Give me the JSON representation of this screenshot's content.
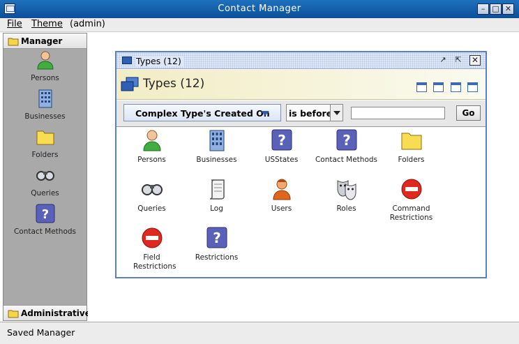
{
  "window": {
    "title": "Contact Manager"
  },
  "menubar": {
    "items": [
      "File",
      "Theme",
      "(admin)"
    ]
  },
  "sidebar": {
    "header": "Manager",
    "footer": "Administrative",
    "items": [
      {
        "label": "Persons",
        "icon": "person-icon"
      },
      {
        "label": "Businesses",
        "icon": "building-icon"
      },
      {
        "label": "Folders",
        "icon": "folder-icon"
      },
      {
        "label": "Queries",
        "icon": "binoculars-icon"
      },
      {
        "label": "Contact Methods",
        "icon": "question-icon"
      }
    ]
  },
  "frame": {
    "title": "Types (12)",
    "header_title": "Types (12)",
    "filter": {
      "field": "Complex Type's Created On",
      "operator": "is before",
      "value": "",
      "go_label": "Go"
    },
    "items": [
      {
        "label": "Persons",
        "icon": "person-icon"
      },
      {
        "label": "Businesses",
        "icon": "building-icon"
      },
      {
        "label": "USStates",
        "icon": "question-icon"
      },
      {
        "label": "Contact Methods",
        "icon": "question-icon"
      },
      {
        "label": "Folders",
        "icon": "folder-icon"
      },
      {
        "label": "Queries",
        "icon": "binoculars-icon"
      },
      {
        "label": "Log",
        "icon": "scroll-icon"
      },
      {
        "label": "Users",
        "icon": "user-icon"
      },
      {
        "label": "Roles",
        "icon": "masks-icon"
      },
      {
        "label": "Command Restrictions",
        "icon": "no-entry-icon"
      },
      {
        "label": "Field Restrictions",
        "icon": "no-entry-icon"
      },
      {
        "label": "Restrictions",
        "icon": "question-icon"
      }
    ]
  },
  "status": {
    "text": "Saved Manager"
  },
  "colors": {
    "titlebar": "#1560b0",
    "sidebar": "#a9a9a9",
    "frame_border": "#5a7fc4",
    "header_bg": "#f2edc4"
  }
}
